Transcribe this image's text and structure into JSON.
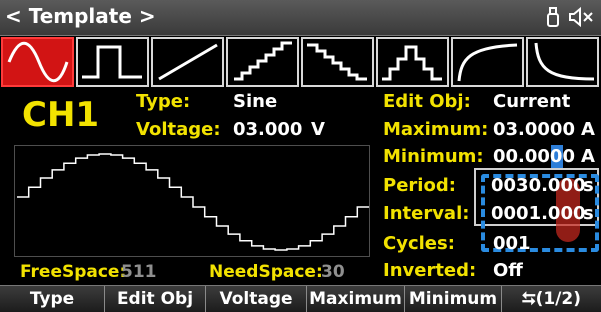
{
  "title": "< Template >",
  "status_icons": [
    "usb-icon",
    "speaker-mute-icon"
  ],
  "waveforms": [
    "sine",
    "square",
    "ramp",
    "stair-up",
    "stair-down",
    "stair-up-down",
    "exp-rise",
    "exp-fall"
  ],
  "selected_waveform": "sine",
  "channel": "CH1",
  "type": {
    "label": "Type:",
    "value": "Sine"
  },
  "voltage": {
    "label": "Voltage:",
    "value": "03.000",
    "unit": "V"
  },
  "edit_obj": {
    "label": "Edit Obj:",
    "value": "Current"
  },
  "maximum": {
    "label": "Maximum:",
    "value": "03.0000",
    "unit": "A"
  },
  "minimum": {
    "label": "Minimum:",
    "value": "00.0000",
    "unit": "A"
  },
  "period": {
    "label": "Period:",
    "value": "0030.000",
    "unit": "s"
  },
  "interval": {
    "label": "Interval:",
    "value": "0001.000",
    "unit": "s"
  },
  "cycles": {
    "label": "Cycles:",
    "value": "001"
  },
  "inverted": {
    "label": "Inverted:",
    "value": "Off"
  },
  "free_space": {
    "label": "FreeSpace:",
    "value": "511"
  },
  "need_space": {
    "label": "NeedSpace:",
    "value": "30"
  },
  "softkeys": [
    "Type",
    "Edit Obj",
    "Voltage",
    "Maximum",
    "Minimum",
    "⮀(1/2)"
  ],
  "colors": {
    "accent_yellow": "#f2e200",
    "selected_red": "#d21414",
    "highlight_blue": "#2a8be0"
  }
}
